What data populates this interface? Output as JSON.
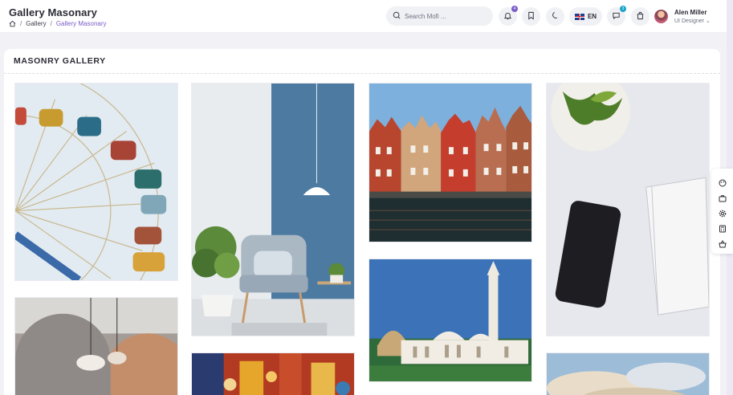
{
  "header": {
    "title": "Gallery Masonary",
    "breadcrumb": [
      "Gallery",
      "Gallery Masonary"
    ],
    "search_placeholder": "Search Mofi ...",
    "notifications_count": "4",
    "messages_count": "3",
    "language": "EN",
    "user": {
      "name": "Alen Miller",
      "role": "UI Designer"
    }
  },
  "main": {
    "card_title": "MASONRY GALLERY"
  },
  "colors": {
    "accent": "#7a5cc7",
    "secondary": "#19a3c9"
  },
  "icons": [
    "home-icon",
    "search-icon",
    "bell-icon",
    "bookmark-icon",
    "moon-icon",
    "chat-icon",
    "bag-icon",
    "palette-icon",
    "briefcase-icon",
    "gear-icon",
    "calculator-icon",
    "basket-icon"
  ]
}
